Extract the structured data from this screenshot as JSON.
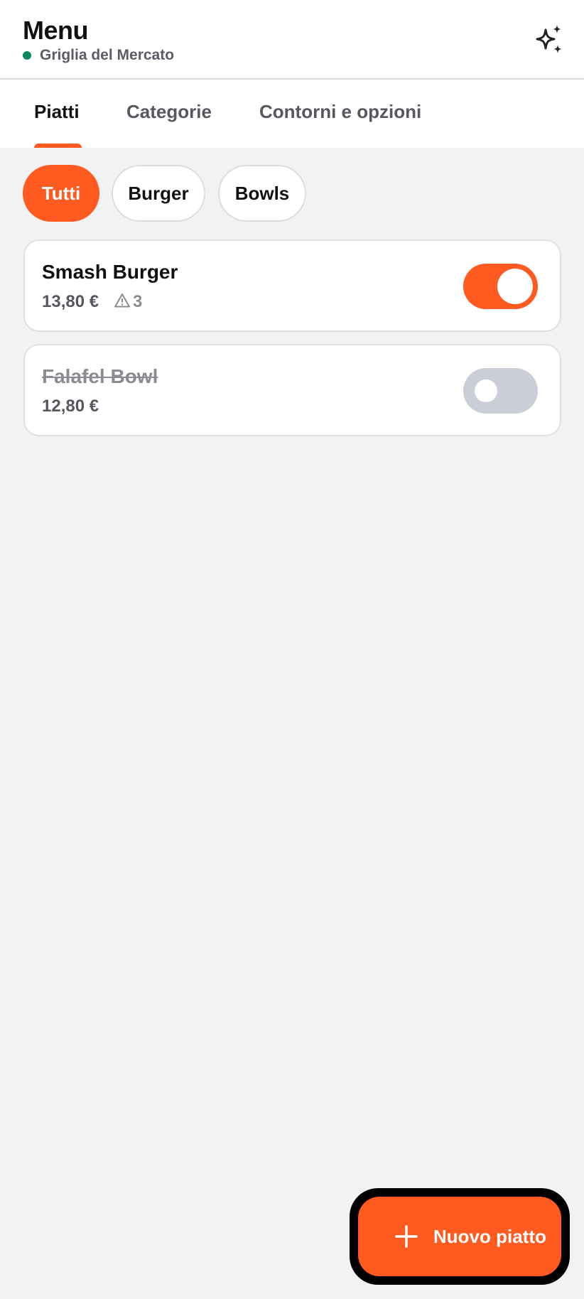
{
  "header": {
    "title": "Menu",
    "restaurant": "Griglia del Mercato",
    "status_color": "#0f8a5f",
    "action_icon": "sparkles-icon"
  },
  "tabs": [
    {
      "label": "Piatti",
      "active": true
    },
    {
      "label": "Categorie",
      "active": false
    },
    {
      "label": "Contorni e opzioni",
      "active": false
    }
  ],
  "filters": [
    {
      "label": "Tutti",
      "active": true
    },
    {
      "label": "Burger",
      "active": false
    },
    {
      "label": "Bowls",
      "active": false
    }
  ],
  "items": [
    {
      "name": "Smash Burger",
      "price": "13,80 €",
      "warning_count": "3",
      "available": true
    },
    {
      "name": "Falafel Bowl",
      "price": "12,80 €",
      "available": false
    }
  ],
  "fab": {
    "label": "Nuovo piatto",
    "icon": "plus-icon"
  },
  "colors": {
    "accent": "#ff5a1f",
    "toggle_off": "#cbced6",
    "background": "#f1f2f4"
  }
}
